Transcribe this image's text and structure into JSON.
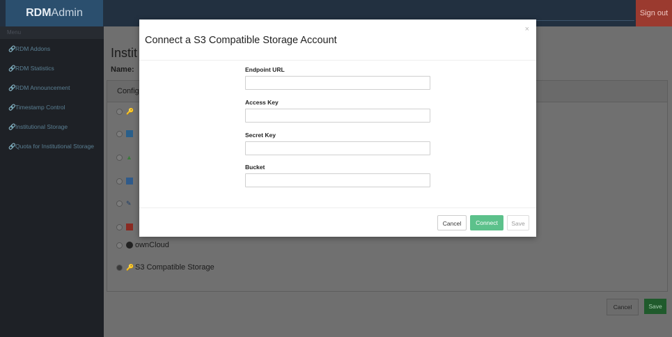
{
  "header": {
    "brand_bold": "RDM",
    "brand_rest": "Admin",
    "signout": "Sign out"
  },
  "sidebar": {
    "menu_head": "Menu",
    "items": [
      {
        "label": "RDM Addons"
      },
      {
        "label": "RDM Statistics"
      },
      {
        "label": "RDM Announcement"
      },
      {
        "label": "Timestamp Control"
      },
      {
        "label": "Institutional Storage"
      },
      {
        "label": "Quota for Institutional Storage"
      }
    ]
  },
  "main": {
    "page_title": "Instit",
    "name_label": "Name:",
    "panel_head": "Config",
    "options": [
      {
        "label": "",
        "icon": "key-icon",
        "selected": false
      },
      {
        "label": "",
        "icon": "box-icon",
        "selected": false
      },
      {
        "label": "",
        "icon": "drive-icon",
        "selected": false
      },
      {
        "label": "",
        "icon": "cloud-icon",
        "selected": false
      },
      {
        "label": "",
        "icon": "pencil-icon",
        "selected": false
      },
      {
        "label": "",
        "icon": "square-icon",
        "selected": false
      },
      {
        "label": "ownCloud",
        "icon": "owncloud-icon",
        "selected": false
      },
      {
        "label": "S3 Compatible Storage",
        "icon": "key-icon",
        "selected": true
      }
    ],
    "cancel": "Cancel",
    "save": "Save"
  },
  "modal": {
    "title": "Connect a S3 Compatible Storage Account",
    "close": "×",
    "fields": [
      {
        "label": "Endpoint URL",
        "value": ""
      },
      {
        "label": "Access Key",
        "value": ""
      },
      {
        "label": "Secret Key",
        "value": ""
      },
      {
        "label": "Bucket",
        "value": ""
      }
    ],
    "cancel": "Cancel",
    "connect": "Connect",
    "save": "Save"
  },
  "colors": {
    "connect": "#5cc18b",
    "signout": "#9b3a2f",
    "save": "#205a2c"
  }
}
